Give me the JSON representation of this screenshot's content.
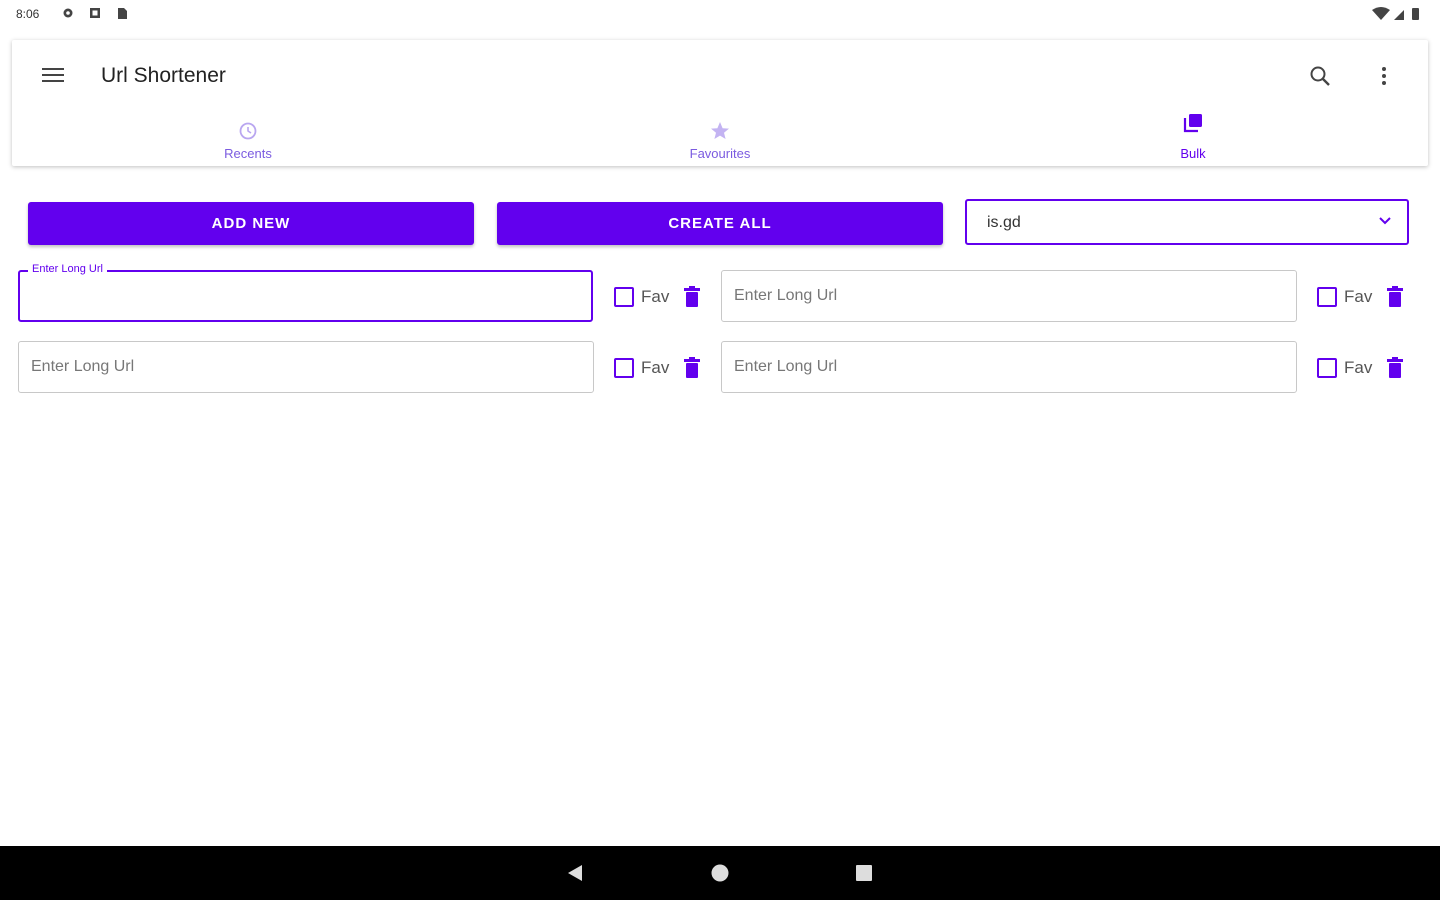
{
  "status_bar": {
    "time": "8:06"
  },
  "app_bar": {
    "title": "Url Shortener",
    "tabs": [
      {
        "label": "Recents",
        "icon": "history-icon"
      },
      {
        "label": "Favourites",
        "icon": "star-icon"
      },
      {
        "label": "Bulk",
        "icon": "library-icon",
        "active": true
      }
    ]
  },
  "toolbar": {
    "add_new_label": "ADD NEW",
    "create_all_label": "CREATE ALL",
    "service_selected": "is.gd"
  },
  "url_rows": {
    "focused_label": "Enter Long Url",
    "placeholder": "Enter Long Url",
    "fav_label": "Fav"
  },
  "colors": {
    "accent": "#6200ee"
  }
}
